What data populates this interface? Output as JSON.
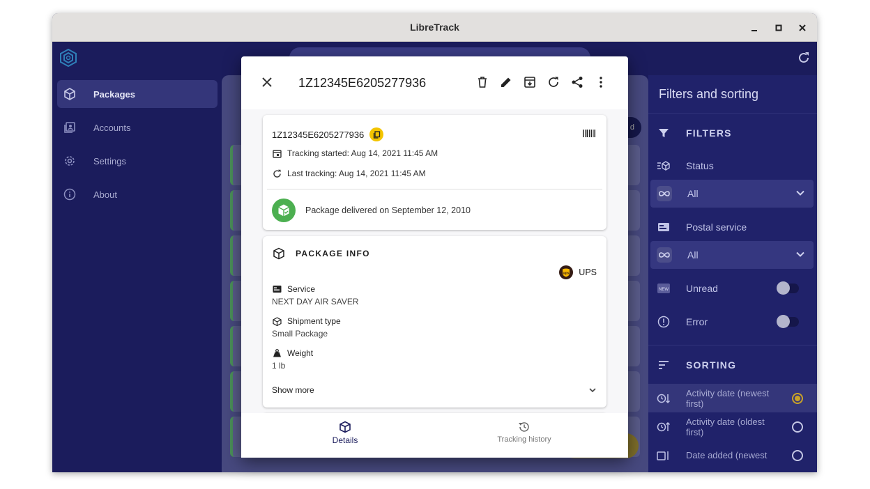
{
  "window": {
    "title": "LibreTrack"
  },
  "nav": {
    "items": [
      {
        "label": "Packages",
        "icon": "package-icon",
        "active": true
      },
      {
        "label": "Accounts",
        "icon": "accounts-icon",
        "active": false
      },
      {
        "label": "Settings",
        "icon": "settings-icon",
        "active": false
      },
      {
        "label": "About",
        "icon": "info-icon",
        "active": false
      }
    ]
  },
  "list": {
    "fab_top_label": "d"
  },
  "panel": {
    "title": "Filters and sorting",
    "filters": {
      "title": "FILTERS",
      "status_label": "Status",
      "status_value": "All",
      "postal_label": "Postal service",
      "postal_value": "All",
      "unread_label": "Unread",
      "error_label": "Error"
    },
    "sorting": {
      "title": "SORTING",
      "items": [
        {
          "label": "Activity date (newest first)",
          "selected": true
        },
        {
          "label": "Activity date (oldest first)",
          "selected": false
        },
        {
          "label": "Date added (newest",
          "selected": false
        }
      ]
    }
  },
  "dialog": {
    "title": "1Z12345E6205277936",
    "tracking": {
      "number": "1Z12345E6205277936",
      "started": "Tracking started: Aug 14, 2021 11:45 AM",
      "last": "Last tracking: Aug 14, 2021 11:45 AM",
      "delivered": "Package delivered on September 12, 2010"
    },
    "package_info": {
      "title": "PACKAGE INFO",
      "carrier": "UPS",
      "service_label": "Service",
      "service_value": "NEXT DAY AIR SAVER",
      "shipment_label": "Shipment type",
      "shipment_value": "Small Package",
      "weight_label": "Weight",
      "weight_value": "1 lb",
      "show_more": "Show more"
    },
    "tabs": [
      {
        "label": "Details",
        "active": true
      },
      {
        "label": "Tracking history",
        "active": false
      }
    ]
  },
  "colors": {
    "accent": "#1b1c5c",
    "gold": "#f3c400",
    "delivered": "#4caf50"
  }
}
